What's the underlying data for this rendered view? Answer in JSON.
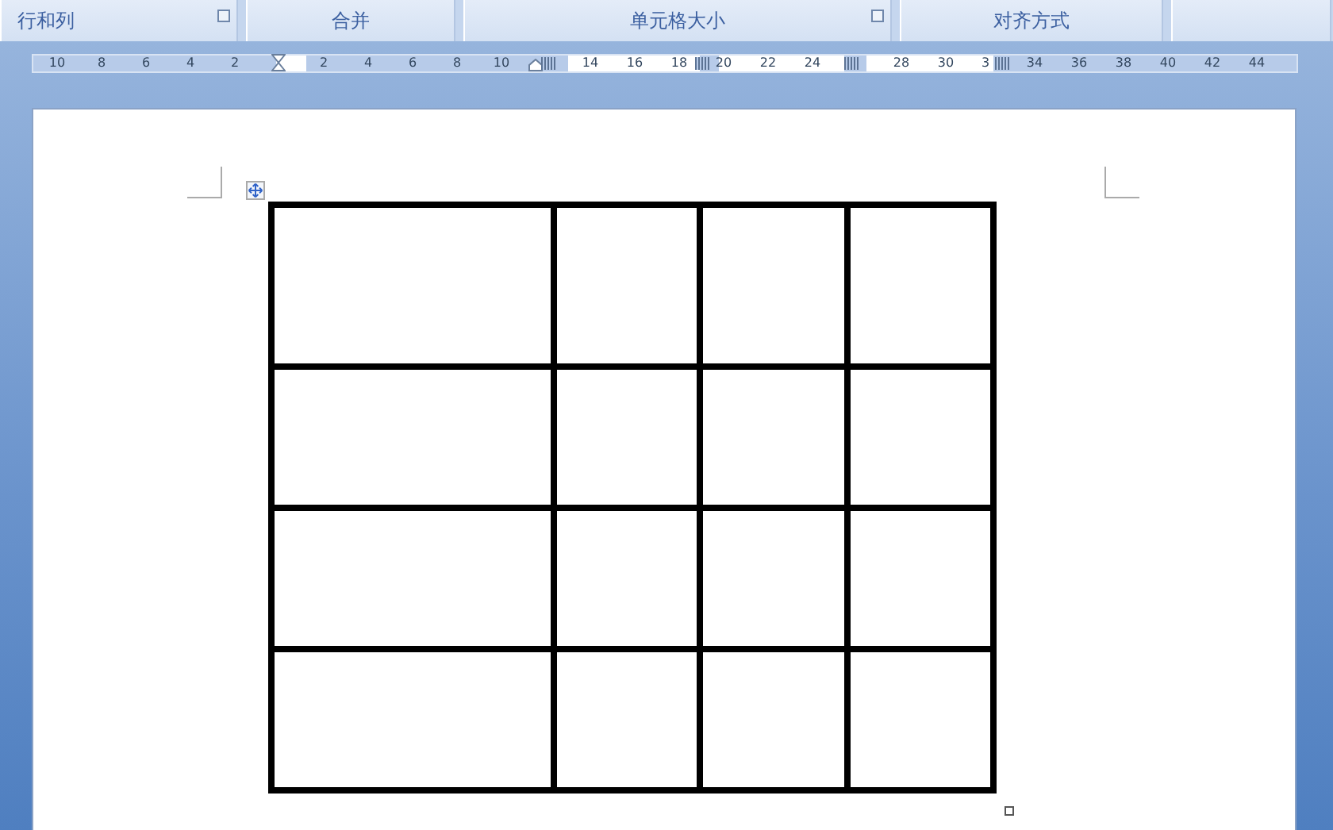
{
  "ribbon_groups": [
    {
      "label": "行和列",
      "launcher": true
    },
    {
      "label": "合并",
      "launcher": false
    },
    {
      "label": "单元格大小",
      "launcher": true
    },
    {
      "label": "对齐方式",
      "launcher": false
    },
    {
      "launcher": false
    }
  ],
  "ruler": {
    "left_numbers": [
      "10",
      "8",
      "6",
      "4",
      "2"
    ],
    "right_numbers": [
      "2",
      "4",
      "6",
      "8",
      "10",
      "14",
      "16",
      "18",
      "20",
      "22",
      "24",
      "28",
      "30",
      "3",
      "34",
      "36",
      "38",
      "40",
      "42",
      "44"
    ]
  },
  "table": {
    "rows": [
      {
        "cells": [
          {
            "kind": "empty"
          },
          {
            "kind": "empty"
          },
          {
            "kind": "empty"
          },
          {
            "kind": "empty"
          }
        ]
      },
      {
        "cells": [
          {
            "kind": "empty"
          },
          {
            "kind": "empty"
          },
          {
            "kind": "empty"
          },
          {
            "kind": "empty"
          }
        ]
      },
      {
        "cells": [
          {
            "kind": "empty"
          },
          {
            "kind": "empty"
          },
          {
            "kind": "empty"
          },
          {
            "kind": "empty"
          }
        ]
      },
      {
        "cells": [
          {
            "kind": "empty"
          },
          {
            "kind": "empty"
          },
          {
            "kind": "empty"
          },
          {
            "kind": "empty"
          }
        ]
      }
    ]
  }
}
